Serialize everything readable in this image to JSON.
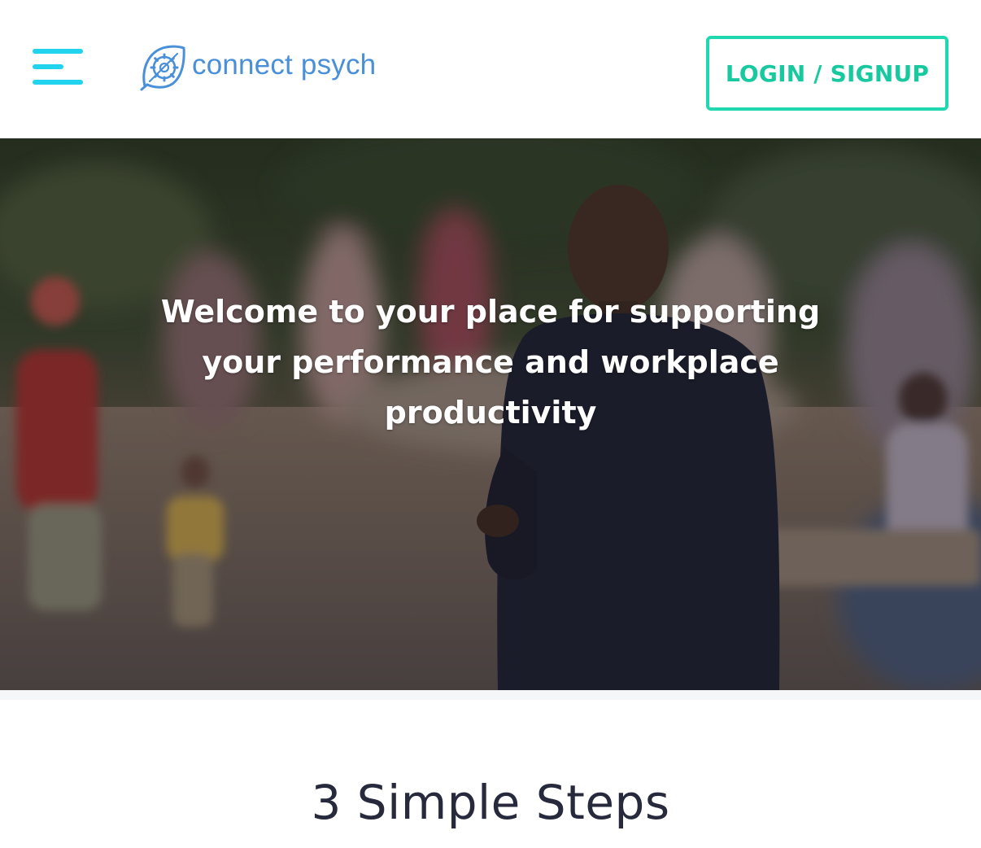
{
  "header": {
    "brand_name": "connect psych",
    "login_label": "LOGIN / SIGNUP",
    "menu_icon": "hamburger-menu-icon",
    "logo_icon": "leaf-gear-logo"
  },
  "hero": {
    "heading": "Welcome to your place for supporting your performance and workplace productivity"
  },
  "steps": {
    "title": "3 Simple Steps"
  },
  "colors": {
    "menu_accent": "#22d3ee",
    "brand_blue": "#4a90d9",
    "login_teal": "#1fd8b0",
    "title_dark": "#27293d"
  }
}
